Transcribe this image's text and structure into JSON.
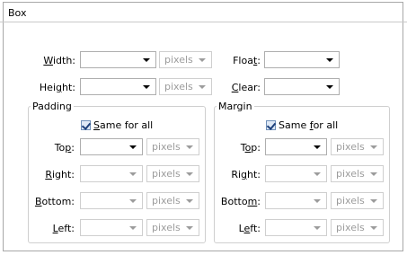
{
  "title": "Box",
  "fields": {
    "width": {
      "pre": "",
      "acc": "W",
      "post": "idth:",
      "units": "pixels"
    },
    "height": {
      "pre": "Hei",
      "acc": "g",
      "post": "ht:",
      "units": "pixels"
    },
    "float": {
      "pre": "Floa",
      "acc": "t",
      "post": ":"
    },
    "clear": {
      "pre": "",
      "acc": "C",
      "post": "lear:"
    }
  },
  "padding": {
    "label": "Padding",
    "same_for_all": {
      "pre": "",
      "acc": "S",
      "post": "ame for all",
      "checked": true
    },
    "top": {
      "pre": "To",
      "acc": "p",
      "post": ":",
      "units": "pixels"
    },
    "right": {
      "pre": "",
      "acc": "R",
      "post": "ight:",
      "units": "pixels"
    },
    "bottom": {
      "pre": "",
      "acc": "B",
      "post": "ottom:",
      "units": "pixels"
    },
    "left": {
      "pre": "",
      "acc": "L",
      "post": "eft:",
      "units": "pixels"
    }
  },
  "margin": {
    "label": "Margin",
    "same_for_all": {
      "pre": "Same ",
      "acc": "f",
      "post": "or all",
      "checked": true
    },
    "top": {
      "pre": "T",
      "acc": "o",
      "post": "p:",
      "units": "pixels"
    },
    "right": {
      "pre": "Ri",
      "acc": "g",
      "post": "ht:",
      "units": "pixels"
    },
    "bottom": {
      "pre": "Botto",
      "acc": "m",
      "post": ":",
      "units": "pixels"
    },
    "left": {
      "pre": "L",
      "acc": "e",
      "post": "ft:",
      "units": "pixels"
    }
  },
  "icons": {
    "dropdown": "chevron-down-icon",
    "checkbox": "checkmark-icon"
  }
}
